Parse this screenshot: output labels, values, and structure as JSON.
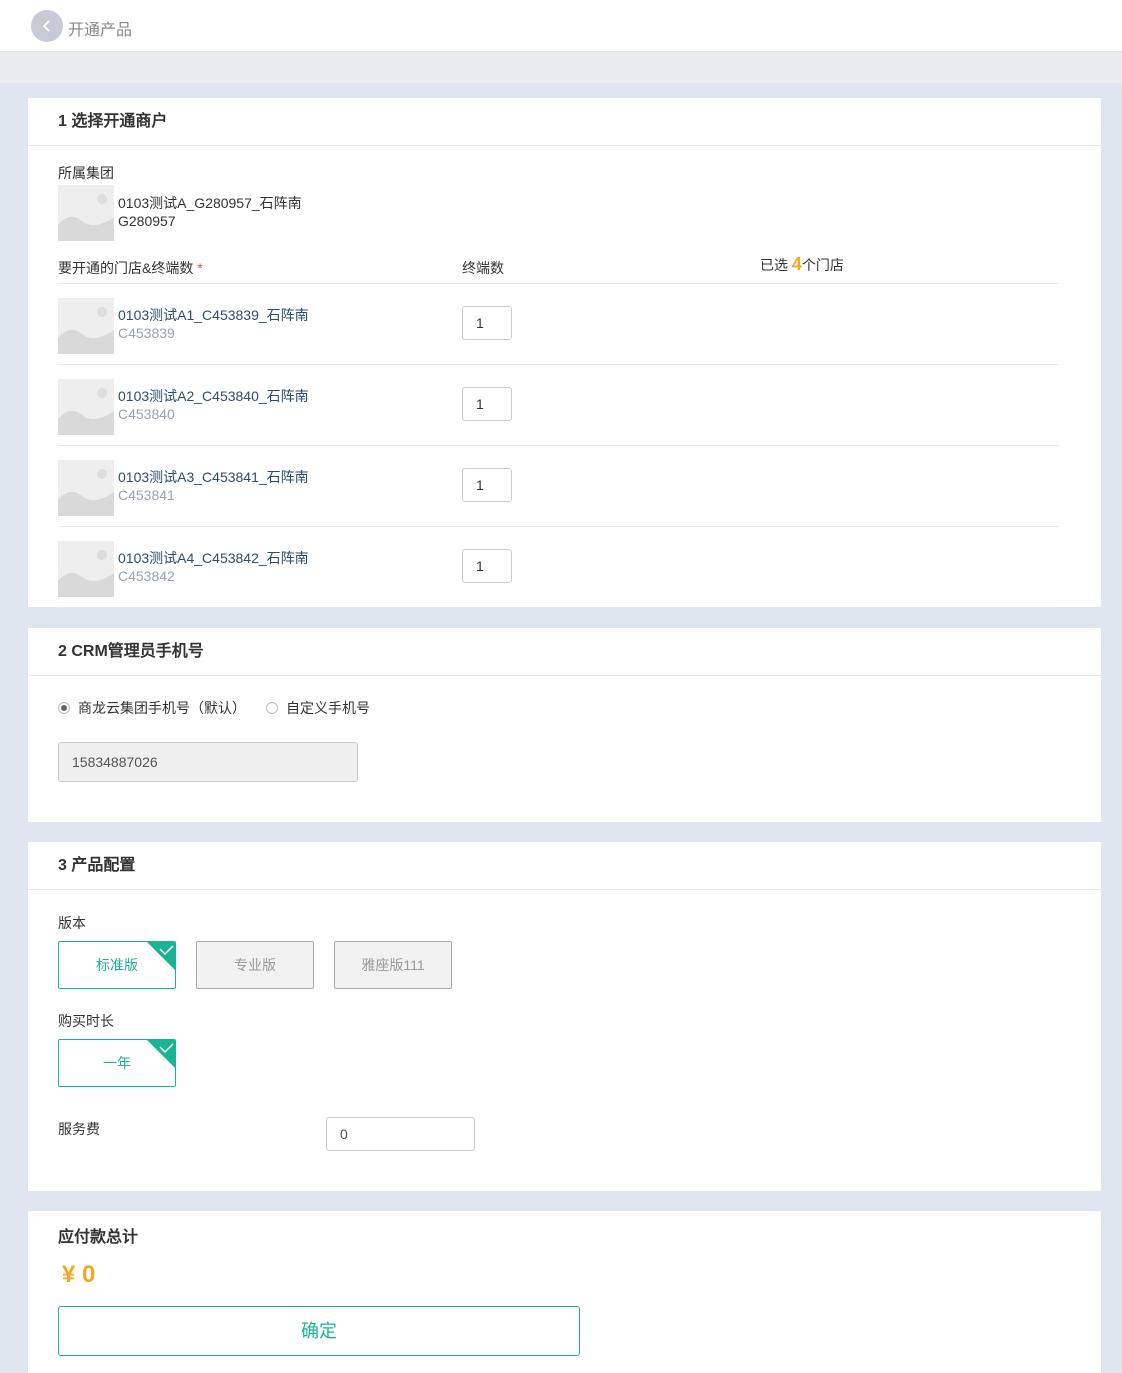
{
  "header": {
    "title": "开通产品"
  },
  "section1": {
    "title": "1 选择开通商户",
    "group_label": "所属集团",
    "group_name": "0103测试A_G280957_石阵南",
    "group_code": "G280957",
    "col_stores": "要开通的门店&终端数",
    "required_mark": "*",
    "col_terminals": "终端数",
    "selected_prefix": "已选 ",
    "selected_count": "4",
    "selected_suffix": "个门店",
    "stores": [
      {
        "name": "0103测试A1_C453839_石阵南",
        "code": "C453839",
        "qty": "1"
      },
      {
        "name": "0103测试A2_C453840_石阵南",
        "code": "C453840",
        "qty": "1"
      },
      {
        "name": "0103测试A3_C453841_石阵南",
        "code": "C453841",
        "qty": "1"
      },
      {
        "name": "0103测试A4_C453842_石阵南",
        "code": "C453842",
        "qty": "1"
      }
    ]
  },
  "section2": {
    "title": "2 CRM管理员手机号",
    "option_default": "商龙云集团手机号（默认）",
    "option_custom": "自定义手机号",
    "selected_option": "option_default",
    "phone": "15834887026"
  },
  "section3": {
    "title": "3 产品配置",
    "edition_label": "版本",
    "editions": [
      "标准版",
      "专业版",
      "雅座版111"
    ],
    "selected_edition": "标准版",
    "duration_label": "购买时长",
    "durations": [
      "一年"
    ],
    "selected_duration": "一年",
    "fee_label": "服务费",
    "fee_value": "0"
  },
  "total": {
    "title": "应付款总计",
    "amount": "¥ 0",
    "confirm_label": "确定"
  },
  "colors": {
    "accent": "#1ab394",
    "highlight": "#f5a623",
    "page_bg": "#dfe6ef"
  }
}
